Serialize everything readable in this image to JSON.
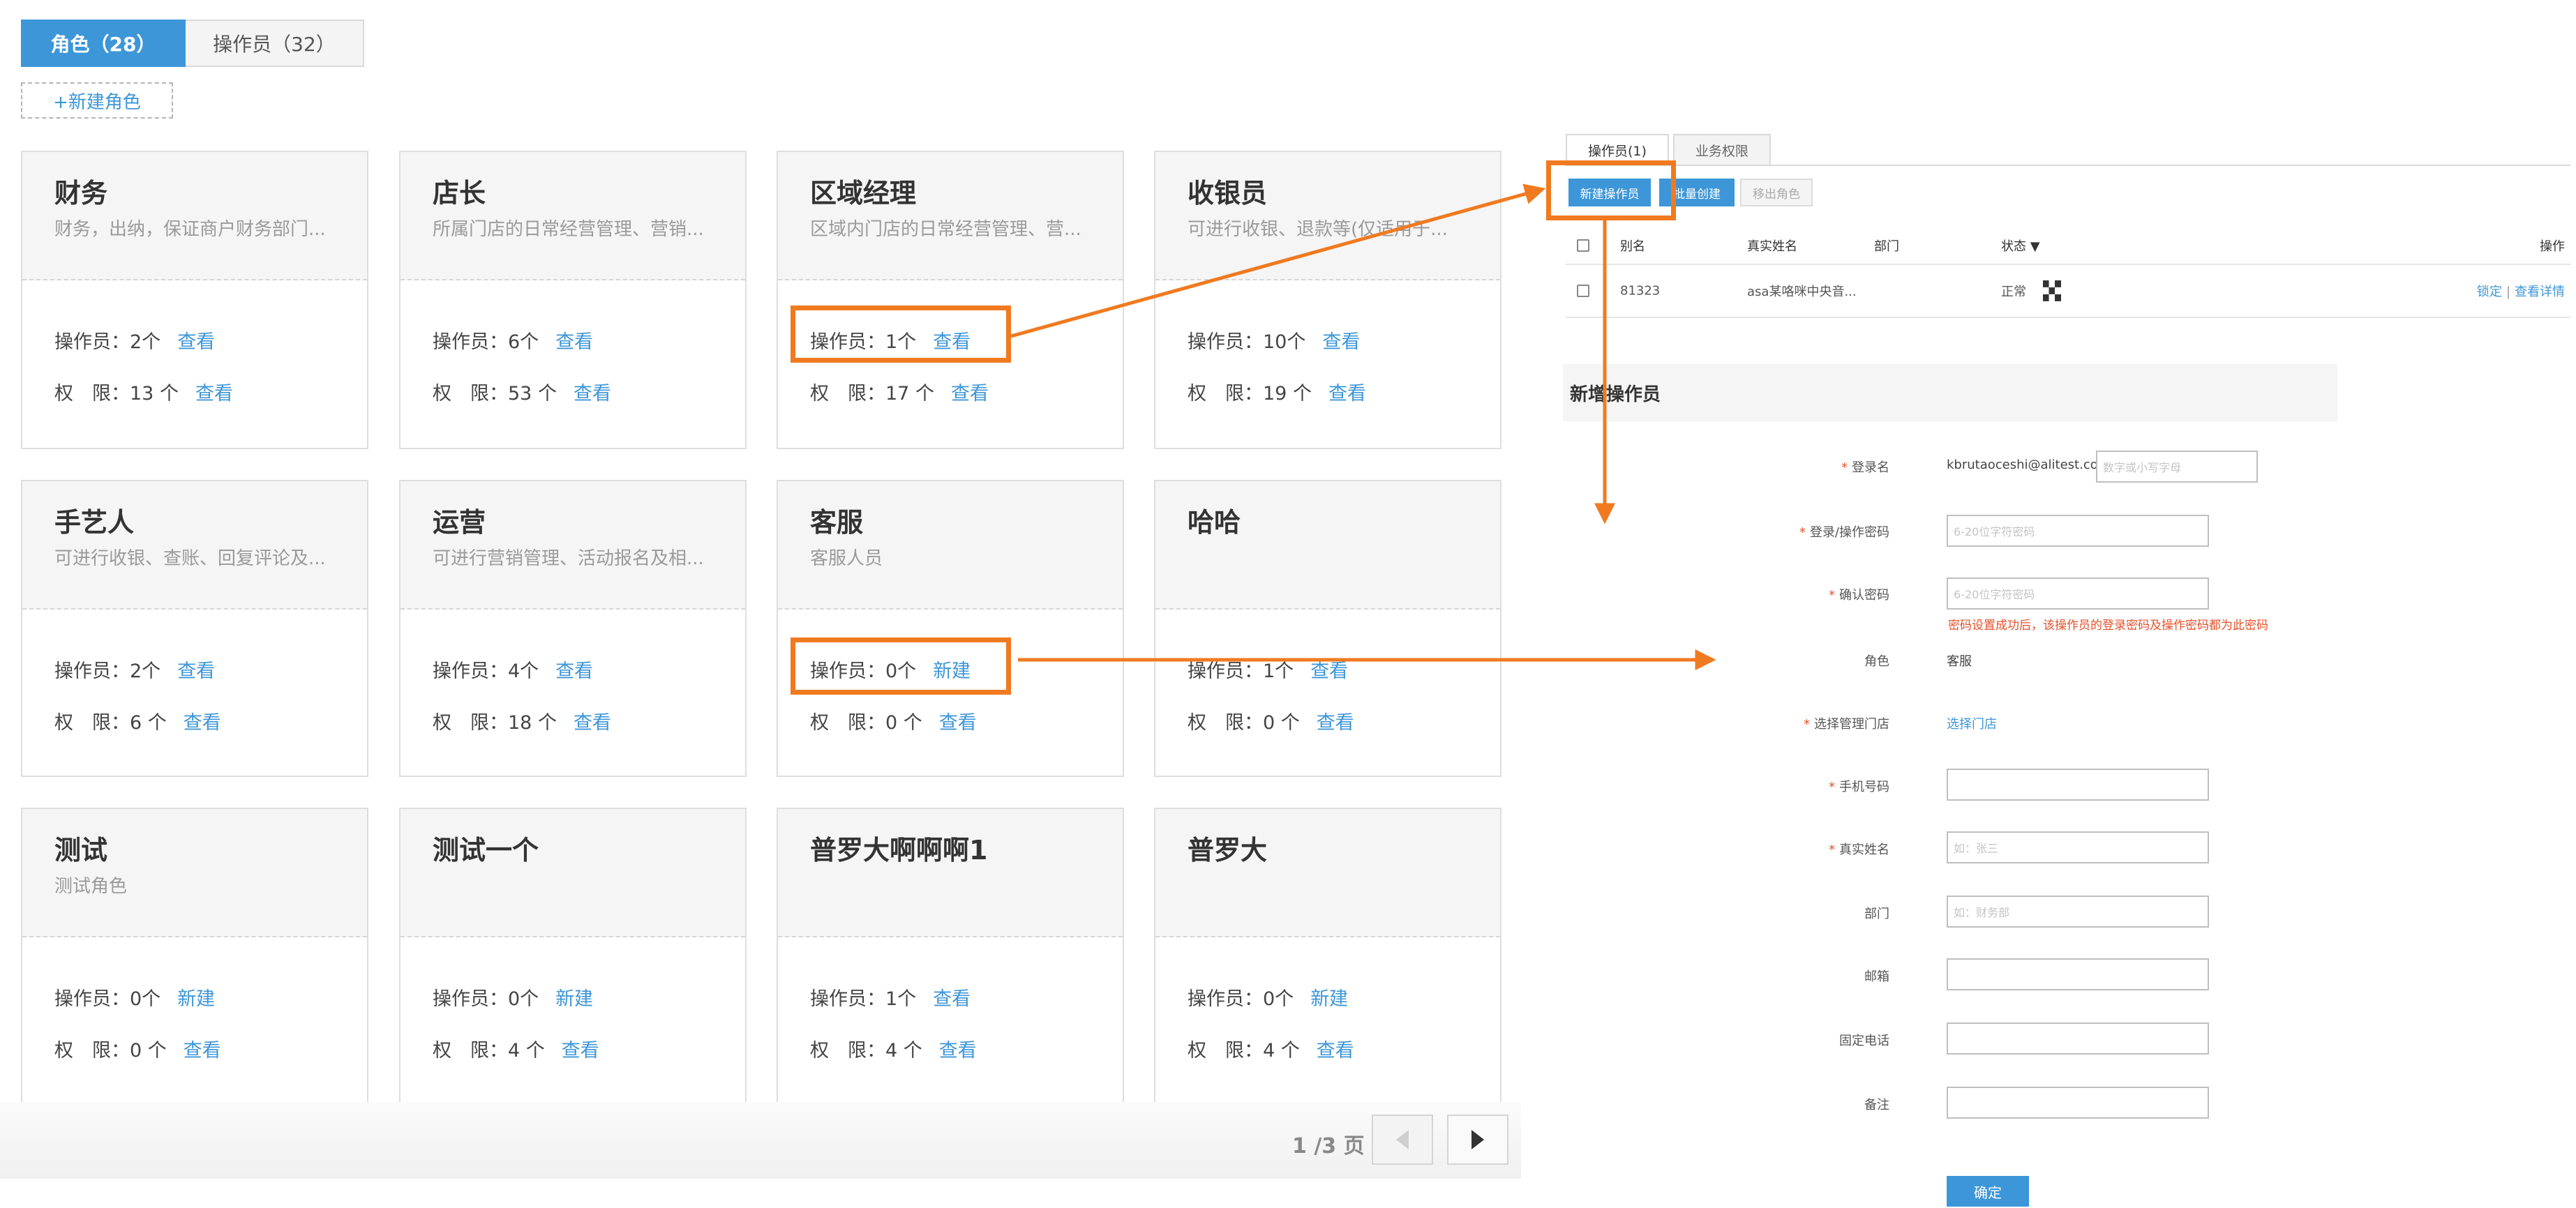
{
  "tabs": [
    {
      "label": "角色（28）",
      "active": true
    },
    {
      "label": "操作员（32）",
      "active": false
    }
  ],
  "new_role_label": "+新建角色",
  "row_labels": {
    "operators": "操作员：",
    "permissions": "权　限："
  },
  "cards": [
    {
      "title": "财务",
      "desc": "财务，出纳，保证商户财务部门...",
      "operators": "2个",
      "operators_link": "查看",
      "permissions": "13 个",
      "permissions_link": "查看"
    },
    {
      "title": "店长",
      "desc": "所属门店的日常经营管理、营销...",
      "operators": "6个",
      "operators_link": "查看",
      "permissions": "53 个",
      "permissions_link": "查看"
    },
    {
      "title": "区域经理",
      "desc": "区域内门店的日常经营管理、营...",
      "operators": "1个",
      "operators_link": "查看",
      "permissions": "17 个",
      "permissions_link": "查看"
    },
    {
      "title": "收银员",
      "desc": "可进行收银、退款等(仅适用于...",
      "operators": "10个",
      "operators_link": "查看",
      "permissions": "19 个",
      "permissions_link": "查看"
    },
    {
      "title": "手艺人",
      "desc": "可进行收银、查账、回复评论及...",
      "operators": "2个",
      "operators_link": "查看",
      "permissions": "6 个",
      "permissions_link": "查看"
    },
    {
      "title": "运营",
      "desc": "可进行营销管理、活动报名及相...",
      "operators": "4个",
      "operators_link": "查看",
      "permissions": "18 个",
      "permissions_link": "查看"
    },
    {
      "title": "客服",
      "desc": "客服人员",
      "operators": "0个",
      "operators_link": "新建",
      "permissions": "0 个",
      "permissions_link": "查看"
    },
    {
      "title": "哈哈",
      "desc": "",
      "operators": "1个",
      "operators_link": "查看",
      "permissions": "0 个",
      "permissions_link": "查看"
    },
    {
      "title": "测试",
      "desc": "测试角色",
      "operators": "0个",
      "operators_link": "新建",
      "permissions": "0 个",
      "permissions_link": "查看"
    },
    {
      "title": "测试一个",
      "desc": "",
      "operators": "0个",
      "operators_link": "新建",
      "permissions": "4 个",
      "permissions_link": "查看"
    },
    {
      "title": "普罗大啊啊啊1",
      "desc": "",
      "operators": "1个",
      "operators_link": "查看",
      "permissions": "4 个",
      "permissions_link": "查看"
    },
    {
      "title": "普罗大",
      "desc": "",
      "operators": "0个",
      "operators_link": "新建",
      "permissions": "4 个",
      "permissions_link": "查看"
    }
  ],
  "pagination": {
    "text": "1 /3 页"
  },
  "panel": {
    "tabs": [
      {
        "label": "操作员(1)",
        "active": true
      },
      {
        "label": "业务权限",
        "active": false
      }
    ],
    "buttons": {
      "new_operator": "新建操作员",
      "batch_create": "批量创建",
      "remove_role": "移出角色"
    },
    "columns": {
      "alias": "别名",
      "real_name": "真实姓名",
      "department": "部门",
      "status": "状态 ▼",
      "actions": "操作"
    },
    "row": {
      "alias": "81323",
      "real_name": "asa某咯咪中央音...",
      "department": "",
      "status": "正常",
      "lock": "锁定",
      "detail": "查看详情"
    }
  },
  "form": {
    "title": "新增操作员",
    "login_label": "登录名",
    "login_prefix": "kbrutaoceshi@alitest.com#",
    "login_placeholder": "数字或小写字母",
    "password_label": "登录/操作密码",
    "password_placeholder": "6-20位字符密码",
    "confirm_label": "确认密码",
    "confirm_placeholder": "6-20位字符密码",
    "password_warning": "密码设置成功后，该操作员的登录密码及操作密码都为此密码",
    "role_label": "角色",
    "role_value": "客服",
    "store_label": "选择管理门店",
    "store_link": "选择门店",
    "phone_label": "手机号码",
    "realname_label": "真实姓名",
    "realname_placeholder": "如：张三",
    "dept_label": "部门",
    "dept_placeholder": "如：财务部",
    "email_label": "邮箱",
    "tel_label": "固定电话",
    "note_label": "备注",
    "submit": "确定"
  },
  "colors": {
    "accent": "#3d96d8",
    "highlight": "#f07a1f",
    "warning": "#e6502a"
  }
}
